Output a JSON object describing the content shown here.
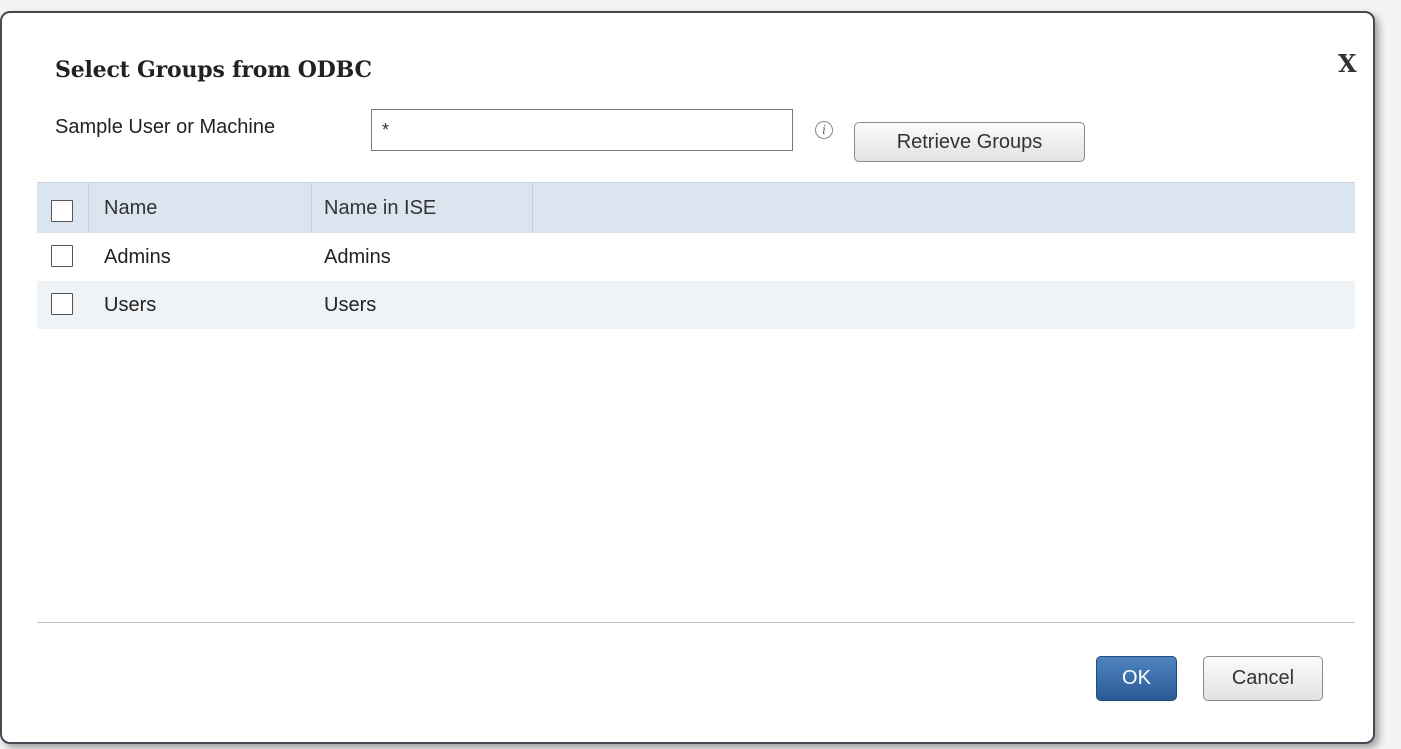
{
  "dialog": {
    "title": "Select Groups from ODBC",
    "close_label": "X"
  },
  "sample": {
    "label": "Sample User or Machine",
    "value": "*"
  },
  "info_icon_glyph": "i",
  "buttons": {
    "retrieve": "Retrieve Groups",
    "ok": "OK",
    "cancel": "Cancel"
  },
  "table": {
    "columns": [
      "Name",
      "Name in ISE"
    ],
    "rows": [
      {
        "name": "Admins",
        "name_in_ise": "Admins"
      },
      {
        "name": "Users",
        "name_in_ise": "Users"
      }
    ]
  },
  "colors": {
    "header_bg": "#dbe5ef",
    "primary_button": "#2a5a94"
  }
}
